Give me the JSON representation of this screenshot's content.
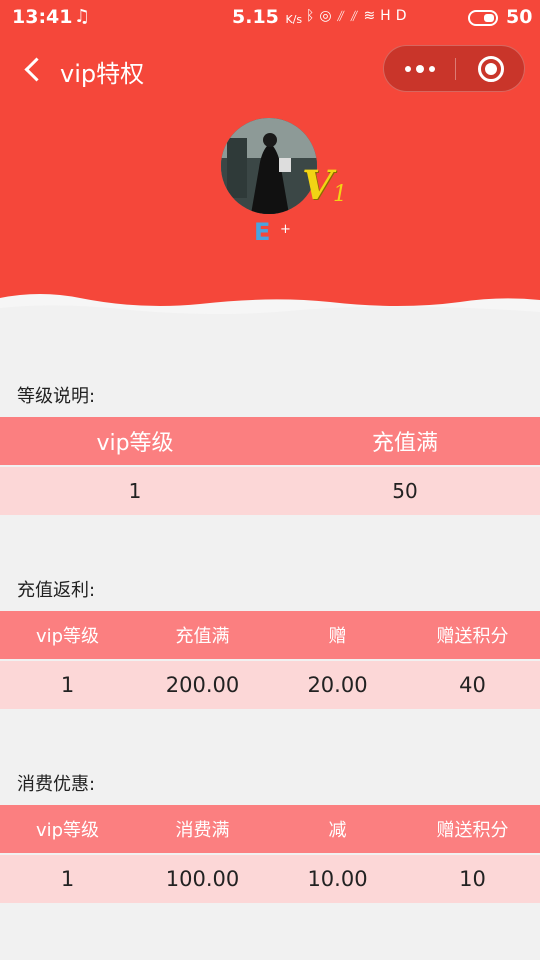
{
  "status_bar": {
    "time": "13:41",
    "speed": "5.15",
    "speed_unit": "K/s",
    "battery": "50"
  },
  "nav": {
    "title": "vip特权"
  },
  "user": {
    "vip_letter": "V",
    "vip_level": "1",
    "name": "E",
    "plus": "+"
  },
  "level_info": {
    "label": "等级说明:",
    "headers": [
      "vip等级",
      "充值满"
    ],
    "row": [
      "1",
      "50"
    ]
  },
  "recharge_rebate": {
    "label": "充值返利:",
    "headers": [
      "vip等级",
      "充值满",
      "赠",
      "赠送积分"
    ],
    "row": [
      "1",
      "200.00",
      "20.00",
      "40"
    ]
  },
  "consume_discount": {
    "label": "消费优惠:",
    "headers": [
      "vip等级",
      "消费满",
      "减",
      "赠送积分"
    ],
    "row": [
      "1",
      "100.00",
      "10.00",
      "10"
    ]
  },
  "colors": {
    "header_bg": "#f5473a",
    "table_head": "#fb7f80",
    "table_row": "#fcd7d7",
    "vip_gold": "#f2d414"
  }
}
